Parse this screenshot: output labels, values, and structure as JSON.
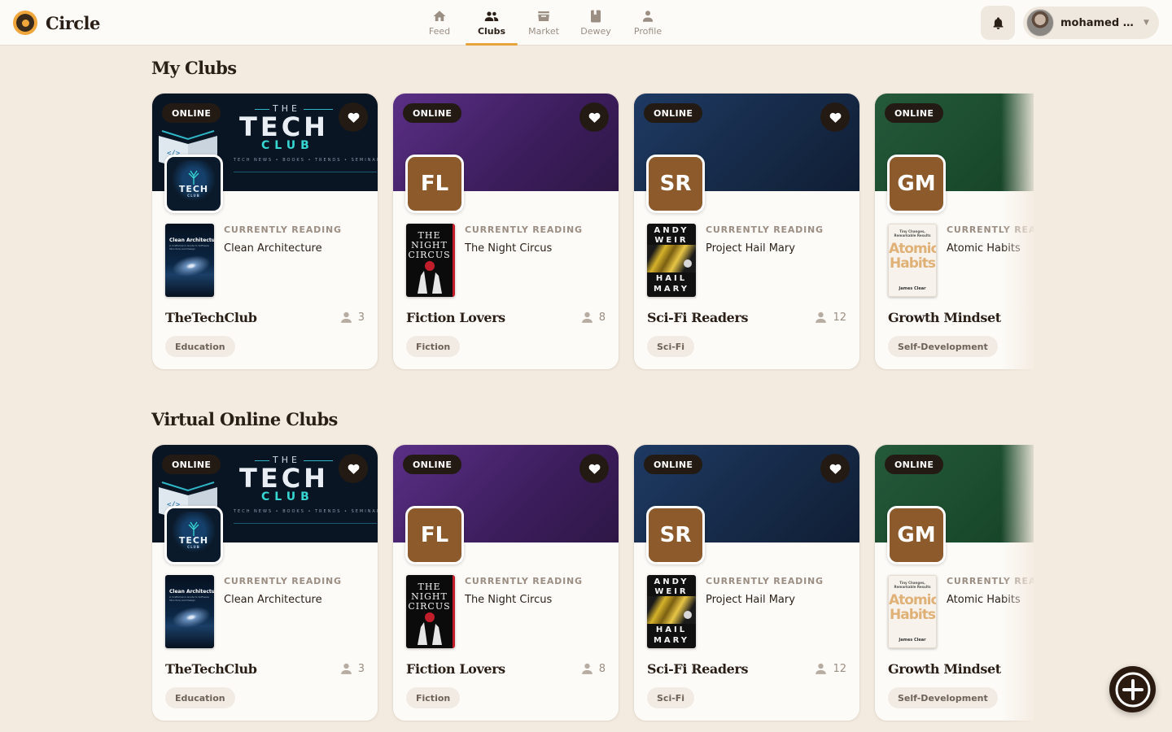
{
  "app": {
    "name": "Circle",
    "colors": {
      "accent": "#e8a43c",
      "background": "#f3ebe0",
      "dark": "#231a14",
      "avatar_brown": "#8d5a2b"
    }
  },
  "nav": {
    "items": [
      {
        "label": "Feed",
        "icon": "home-icon",
        "active": false
      },
      {
        "label": "Clubs",
        "icon": "group-icon",
        "active": true
      },
      {
        "label": "Market",
        "icon": "store-icon",
        "active": false
      },
      {
        "label": "Dewey",
        "icon": "book-icon",
        "active": false
      },
      {
        "label": "Profile",
        "icon": "person-icon",
        "active": false
      }
    ]
  },
  "header": {
    "notifications_icon": "bell-icon",
    "user": {
      "name": "mohamed a...",
      "avatar_icon": "user-photo-avatar",
      "menu_icon": "chevron-down-icon"
    }
  },
  "sections": [
    {
      "title": "My Clubs",
      "clubs": [
        {
          "badge": "ONLINE",
          "banner": "tech",
          "initials": "",
          "reading_label": "CURRENTLY READING",
          "book": "Clean Architecture",
          "cover": "clean",
          "name": "TheTechClub",
          "members": "3",
          "category": "Education",
          "favorited": true
        },
        {
          "badge": "ONLINE",
          "banner": "purple",
          "initials": "FL",
          "reading_label": "CURRENTLY READING",
          "book": "The Night Circus",
          "cover": "night",
          "name": "Fiction Lovers",
          "members": "8",
          "category": "Fiction",
          "favorited": true
        },
        {
          "badge": "ONLINE",
          "banner": "blue",
          "initials": "SR",
          "reading_label": "CURRENTLY READING",
          "book": "Project Hail Mary",
          "cover": "hail",
          "name": "Sci-Fi Readers",
          "members": "12",
          "category": "Sci-Fi",
          "favorited": true
        },
        {
          "badge": "ONLINE",
          "banner": "green",
          "initials": "GM",
          "reading_label": "CURRENTLY READING",
          "book": "Atomic Habits",
          "cover": "atomic",
          "name": "Growth Mindset",
          "members": "",
          "category": "Self-Development",
          "favorited": false
        }
      ]
    },
    {
      "title": "Virtual Online Clubs",
      "clubs": [
        {
          "badge": "ONLINE",
          "banner": "tech",
          "initials": "",
          "reading_label": "CURRENTLY READING",
          "book": "Clean Architecture",
          "cover": "clean",
          "name": "TheTechClub",
          "members": "3",
          "category": "Education",
          "favorited": true
        },
        {
          "badge": "ONLINE",
          "banner": "purple",
          "initials": "FL",
          "reading_label": "CURRENTLY READING",
          "book": "The Night Circus",
          "cover": "night",
          "name": "Fiction Lovers",
          "members": "8",
          "category": "Fiction",
          "favorited": true
        },
        {
          "badge": "ONLINE",
          "banner": "blue",
          "initials": "SR",
          "reading_label": "CURRENTLY READING",
          "book": "Project Hail Mary",
          "cover": "hail",
          "name": "Sci-Fi Readers",
          "members": "12",
          "category": "Sci-Fi",
          "favorited": true
        },
        {
          "badge": "ONLINE",
          "banner": "green",
          "initials": "GM",
          "reading_label": "CURRENTLY READING",
          "book": "Atomic Habits",
          "cover": "atomic",
          "name": "Growth Mindset",
          "members": "",
          "category": "Self-Development",
          "favorited": false
        }
      ]
    }
  ],
  "covers": {
    "clean": {
      "title": "Clean Architecture",
      "subtitle": "A Craftsman's Guide to Software Structure and Design"
    },
    "night": {
      "title": "THE NIGHT CIRCUS"
    },
    "hail": {
      "author_line1": "ANDY",
      "author_line2": "WEIR",
      "title_line1": "HAIL",
      "title_line2": "MARY"
    },
    "atomic": {
      "subtitle": "Tiny Changes, Remarkable Results",
      "title_line1": "Atomic",
      "title_line2": "Habits",
      "author": "James Clear"
    }
  },
  "tech_banner": {
    "the": "THE",
    "main": "TECH",
    "club": "CLUB",
    "tagline": "TECH NEWS • BOOKS • TRENDS • SEMINARS",
    "logo_text": "TECH",
    "logo_small": "CLUB"
  },
  "fab": {
    "icon": "plus-icon"
  }
}
